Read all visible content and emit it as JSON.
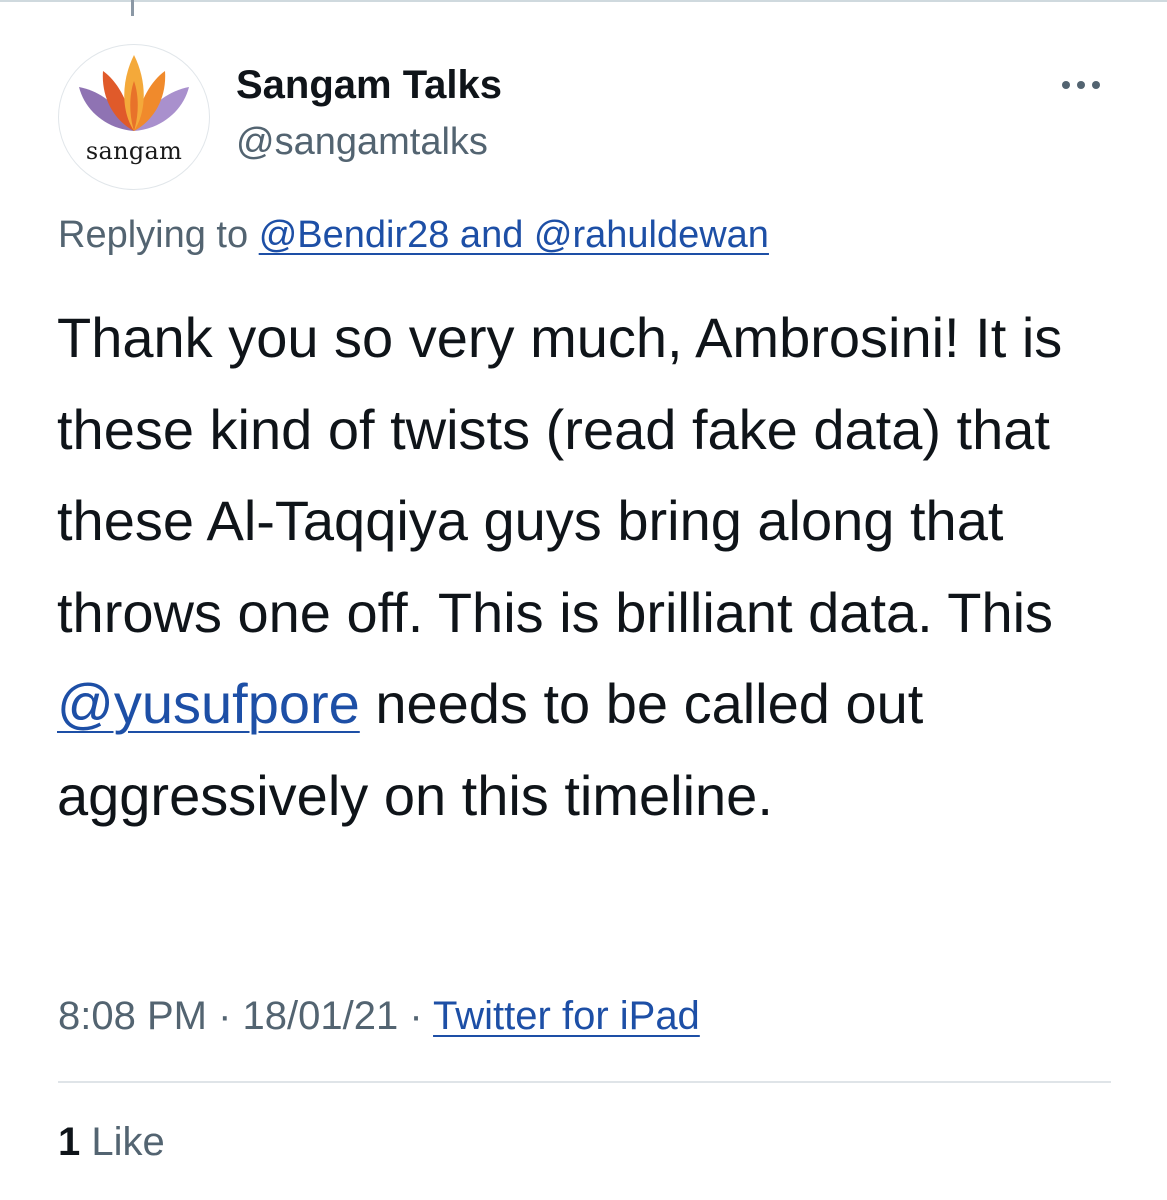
{
  "author": {
    "display_name": "Sangam Talks",
    "handle": "@sangamtalks",
    "avatar_text": "sangam"
  },
  "reply": {
    "prefix": "Replying to",
    "targets": "@Bendir28 and @rahuldewan"
  },
  "tweet": {
    "text_before": "Thank you so very much, Ambrosini! It is these kind of twists (read fake data) that these Al-Taqqiya guys bring along that throws one off. This is brilliant data. This ",
    "mention": "@yusufpore",
    "text_after": " needs to be called out aggressively on this timeline."
  },
  "meta": {
    "time": "8:08 PM",
    "separator": " · ",
    "date": "18/01/21",
    "source": "Twitter for iPad"
  },
  "stats": {
    "like_count": "1",
    "like_label": "Like"
  },
  "icons": {
    "more": "more-options-icon",
    "logo": "lotus-icon"
  },
  "colors": {
    "link": "#1d4fa6",
    "secondary_text": "#536471",
    "primary_text": "#0f1419",
    "lotus_orange": "#e8722a",
    "lotus_purple": "#7b5aa6"
  }
}
